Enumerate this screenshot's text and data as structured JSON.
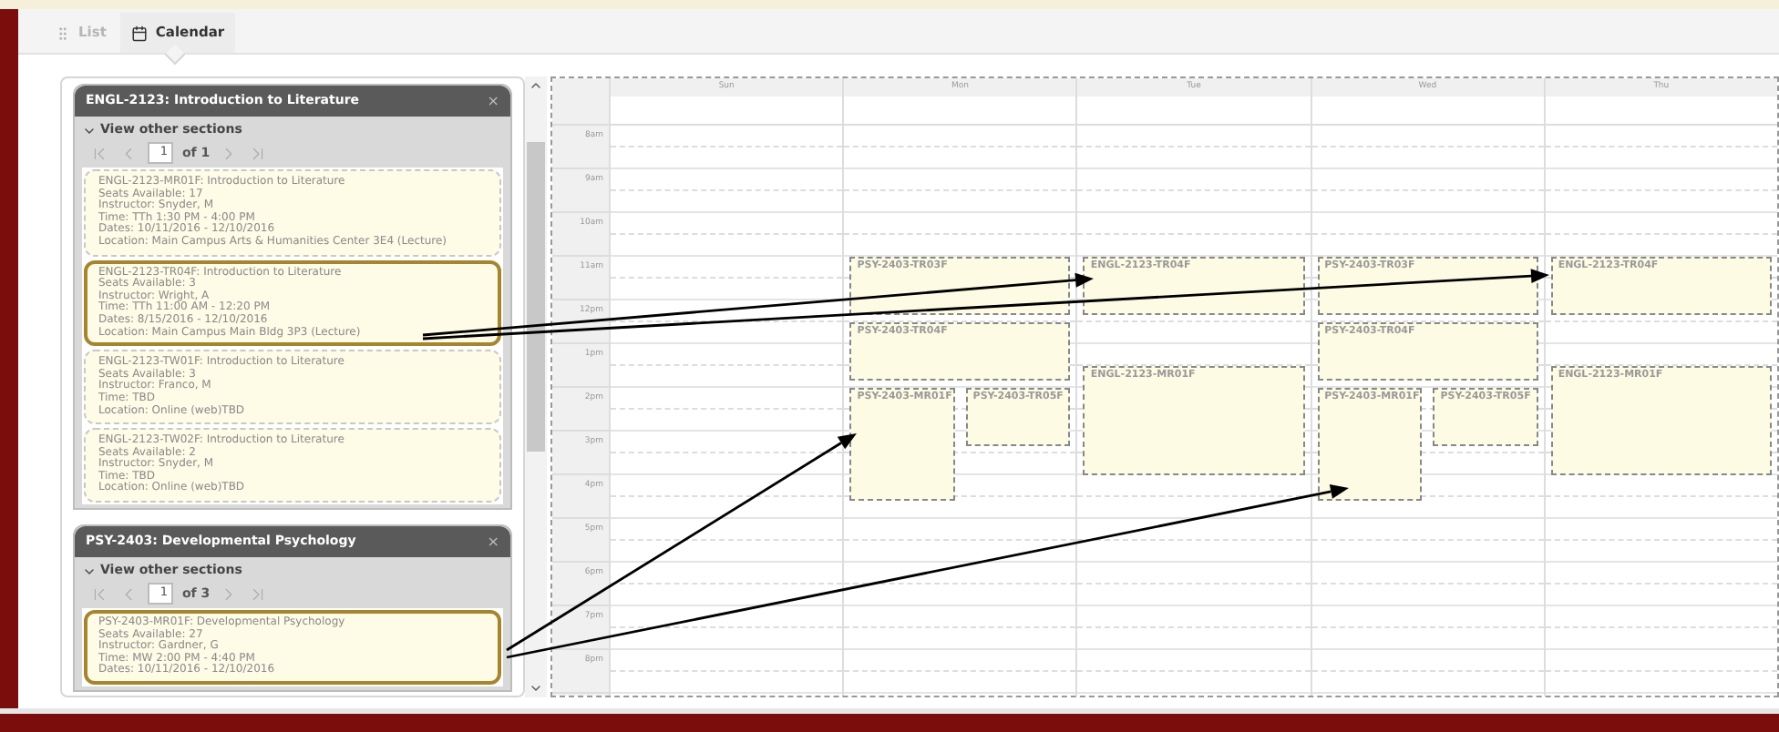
{
  "tabs": [
    {
      "label": "List",
      "kind": "list",
      "selected": false
    },
    {
      "label": "Calendar",
      "kind": "calendar",
      "selected": true
    }
  ],
  "courses": [
    {
      "title": "ENGL-2123: Introduction to Literature",
      "close": "×",
      "toggle": "View other sections",
      "expanded": true,
      "page": "1",
      "page_count": "of 1",
      "sections": [
        {
          "selected": false,
          "lines": [
            "ENGL-2123-MR01F: Introduction to Literature",
            "Seats Available: 17",
            "Instructor: Snyder, M",
            "Time: TTh 1:30 PM - 4:00 PM",
            "Dates: 10/11/2016 - 12/10/2016",
            "Location: Main Campus Arts & Humanities Center 3E4 (Lecture)"
          ]
        },
        {
          "selected": true,
          "lines": [
            "ENGL-2123-TR04F: Introduction to Literature",
            "Seats Available: 3",
            "Instructor: Wright, A",
            "Time: TTh 11:00 AM - 12:20 PM",
            "Dates: 8/15/2016 - 12/10/2016",
            "Location: Main Campus Main Bldg 3P3 (Lecture)"
          ]
        },
        {
          "selected": false,
          "lines": [
            "ENGL-2123-TW01F: Introduction to Literature",
            "Seats Available: 3",
            "Instructor: Franco, M",
            "Time: TBD",
            "Location: Online (web)TBD"
          ]
        },
        {
          "selected": false,
          "lines": [
            "ENGL-2123-TW02F: Introduction to Literature",
            "Seats Available: 2",
            "Instructor: Snyder, M",
            "Time: TBD",
            "Location: Online (web)TBD"
          ]
        }
      ]
    },
    {
      "title": "PSY-2403: Developmental Psychology",
      "close": "×",
      "toggle": "View other sections",
      "expanded": true,
      "page": "1",
      "page_count": "of 3",
      "sections": [
        {
          "selected": true,
          "lines": [
            "PSY-2403-MR01F: Developmental Psychology",
            "Seats Available: 27",
            "Instructor: Gardner, G",
            "Time: MW 2:00 PM - 4:40 PM",
            "Dates: 10/11/2016 - 12/10/2016"
          ]
        }
      ]
    }
  ],
  "calendar": {
    "hours": [
      "8am",
      "9am",
      "10am",
      "11am",
      "12pm",
      "1pm",
      "2pm",
      "3pm",
      "4pm",
      "5pm",
      "6pm",
      "7pm",
      "8pm"
    ],
    "days": [
      {
        "label": "Sun"
      },
      {
        "label": "Mon",
        "events": [
          {
            "label": "PSY-2403-TR03F"
          },
          {
            "label": "PSY-2403-TR04F"
          },
          {
            "label": "PSY-2403-MR01F"
          },
          {
            "label": "PSY-2403-TR05F"
          }
        ]
      },
      {
        "label": "Tue",
        "events": [
          {
            "label": "ENGL-2123-TR04F"
          },
          {
            "label": "ENGL-2123-MR01F"
          }
        ]
      },
      {
        "label": "Wed",
        "events": [
          {
            "label": "PSY-2403-TR03F"
          },
          {
            "label": "PSY-2403-TR04F"
          },
          {
            "label": "PSY-2403-MR01F"
          },
          {
            "label": "PSY-2403-TR05F"
          }
        ]
      },
      {
        "label": "Thu",
        "events": [
          {
            "label": "ENGL-2123-TR04F"
          },
          {
            "label": "ENGL-2123-MR01F"
          }
        ]
      }
    ]
  }
}
